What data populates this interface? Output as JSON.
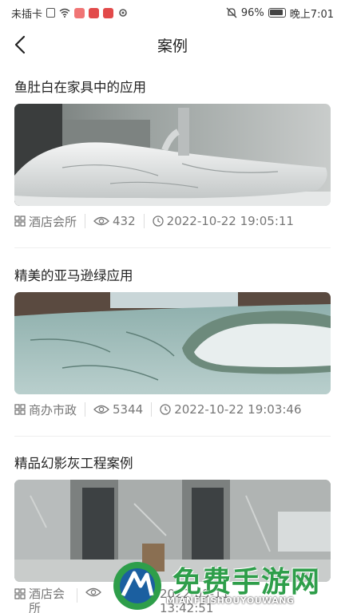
{
  "status_bar": {
    "carrier": "未插卡",
    "battery": "96%",
    "time": "晚上7:01"
  },
  "header": {
    "title": "案例"
  },
  "cases": [
    {
      "title": "鱼肚白在家具中的应用",
      "category": "酒店会所",
      "views": "432",
      "datetime": "2022-10-22 19:05:11"
    },
    {
      "title": "精美的亚马逊绿应用",
      "category": "商办市政",
      "views": "5344",
      "datetime": "2022-10-22 19:03:46"
    },
    {
      "title": "精品幻影灰工程案例",
      "category": "酒店会所",
      "views": "",
      "datetime": "2022-09-11 13:42:51"
    }
  ],
  "watermark": {
    "text": "免费手游网",
    "sub": "MIANFEISHOUYOUWANG"
  },
  "colors": {
    "text_primary": "#222222",
    "text_meta": "#777777",
    "separator": "#eeeeee",
    "watermark_green": "#2e9e4a"
  }
}
